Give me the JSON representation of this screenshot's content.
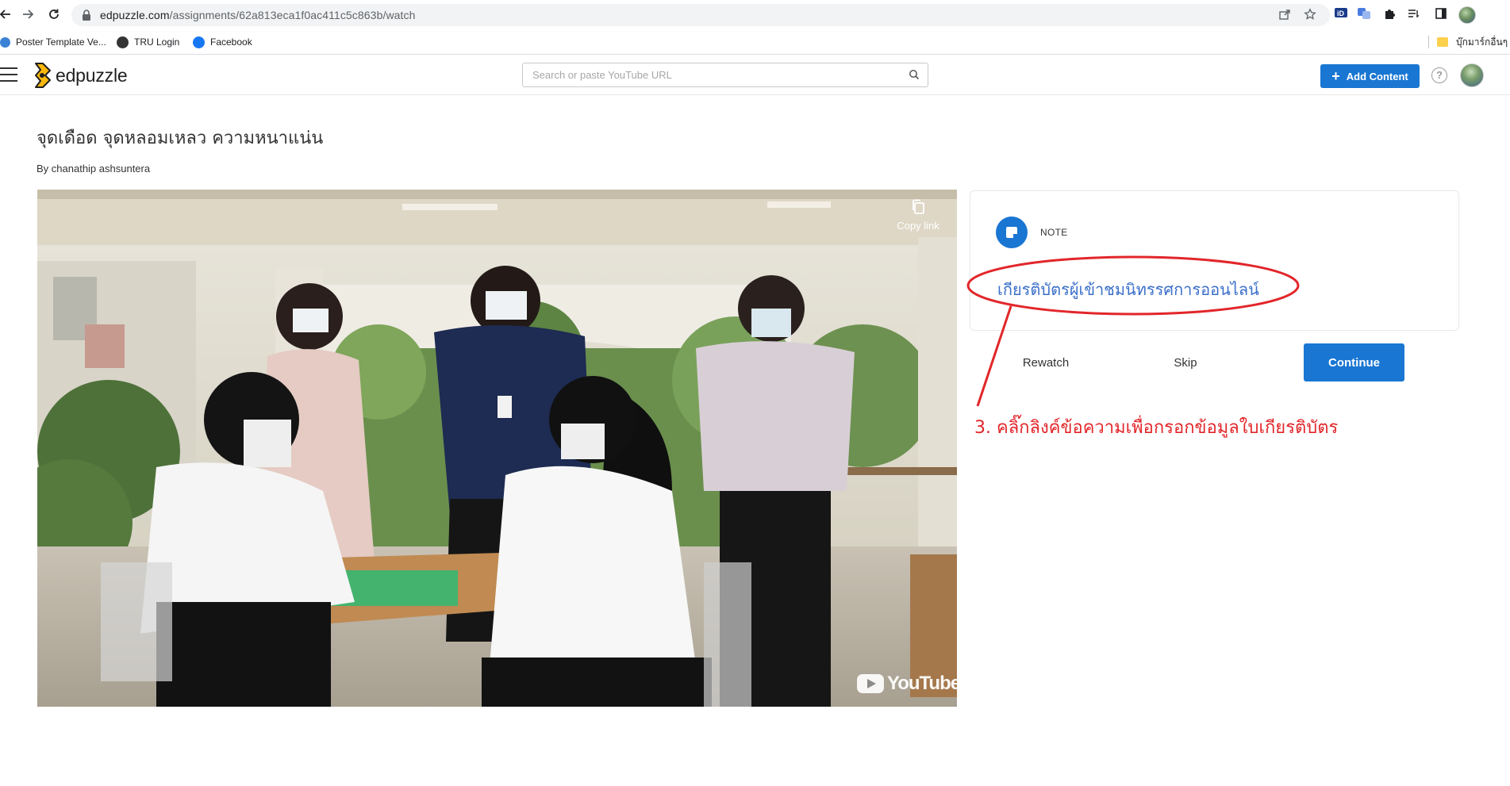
{
  "browser": {
    "url_host": "edpuzzle.com",
    "url_path": "/assignments/62a813eca1f0ac411c5c863b/watch",
    "bookmarks": [
      {
        "label": "Poster Template Ve...",
        "icon": "globe-icon"
      },
      {
        "label": "TRU Login",
        "icon": "tru-icon"
      },
      {
        "label": "Facebook",
        "icon": "facebook-icon"
      }
    ],
    "bookmark_folder": "บุ๊กมาร์กอื่นๆ"
  },
  "app": {
    "logo_text": "edpuzzle",
    "search_placeholder": "Search or paste YouTube URL",
    "add_content_label": "Add Content",
    "help_label": "?",
    "accent_color": "#1976d2"
  },
  "video": {
    "title": "จุดเดือด จุดหลอมเหลว ความหนาแน่น",
    "author": "By chanathip ashsuntera",
    "copy_link_label": "Copy link",
    "youtube_label": "YouTube"
  },
  "note": {
    "label": "NOTE",
    "link_text": "เกียรติบัตรผู้เข้าชมนิทรรศการออนไลน์"
  },
  "actions": {
    "rewatch": "Rewatch",
    "skip": "Skip",
    "continue": "Continue"
  },
  "annotation": {
    "text": "3. คลิ๊กลิงค์ข้อความเพื่อกรอกข้อมูลใบเกียรติบัตร",
    "color": "#e2262a"
  }
}
